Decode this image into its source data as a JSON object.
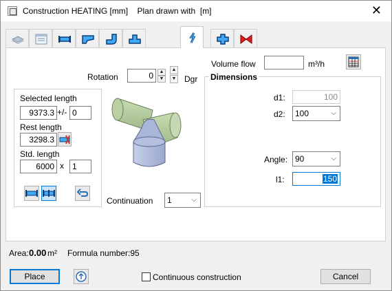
{
  "window": {
    "title": "Construction HEATING [mm]    Plan drawn with  [m]",
    "close_glyph": "✕"
  },
  "tabs": [
    {
      "icon": "layer-icon"
    },
    {
      "icon": "properties-icon"
    },
    {
      "icon": "straight-duct-icon"
    },
    {
      "icon": "bend-icon"
    },
    {
      "icon": "elbow-icon"
    },
    {
      "icon": "tee-icon"
    },
    {
      "icon": "branch-icon",
      "active": true
    },
    {
      "icon": "cross-icon"
    },
    {
      "icon": "valve-icon"
    }
  ],
  "rotation": {
    "label": "Rotation",
    "value": "0",
    "unit": "Dgr"
  },
  "volume_flow": {
    "label": "Volume flow",
    "value": "",
    "unit": "m³/h"
  },
  "lengths": {
    "selected_label": "Selected length",
    "selected_value": "9373.3",
    "plus_minus": "+/-",
    "tolerance_value": "0",
    "rest_label": "Rest length",
    "rest_value": "3298.3",
    "std_label": "Std. length",
    "std_value": "6000",
    "times": "x",
    "count_value": "1"
  },
  "dimensions": {
    "title": "Dimensions",
    "d1_label": "d1:",
    "d1_value": "100",
    "d2_label": "d2:",
    "d2_value": "100",
    "angle_label": "Angle:",
    "angle_value": "90",
    "l1_label": "l1:",
    "l1_value": "150"
  },
  "continuation": {
    "label": "Continuation",
    "value": "1"
  },
  "footer": {
    "area_label": "Area:",
    "area_value": "0.00",
    "area_unit": "m²",
    "formula_text": "Formula number:95"
  },
  "buttons": {
    "place": "Place",
    "continuous": "Continuous construction",
    "cancel": "Cancel"
  },
  "colors": {
    "accent": "#0078d7",
    "pipe": "#c6dcb0"
  }
}
